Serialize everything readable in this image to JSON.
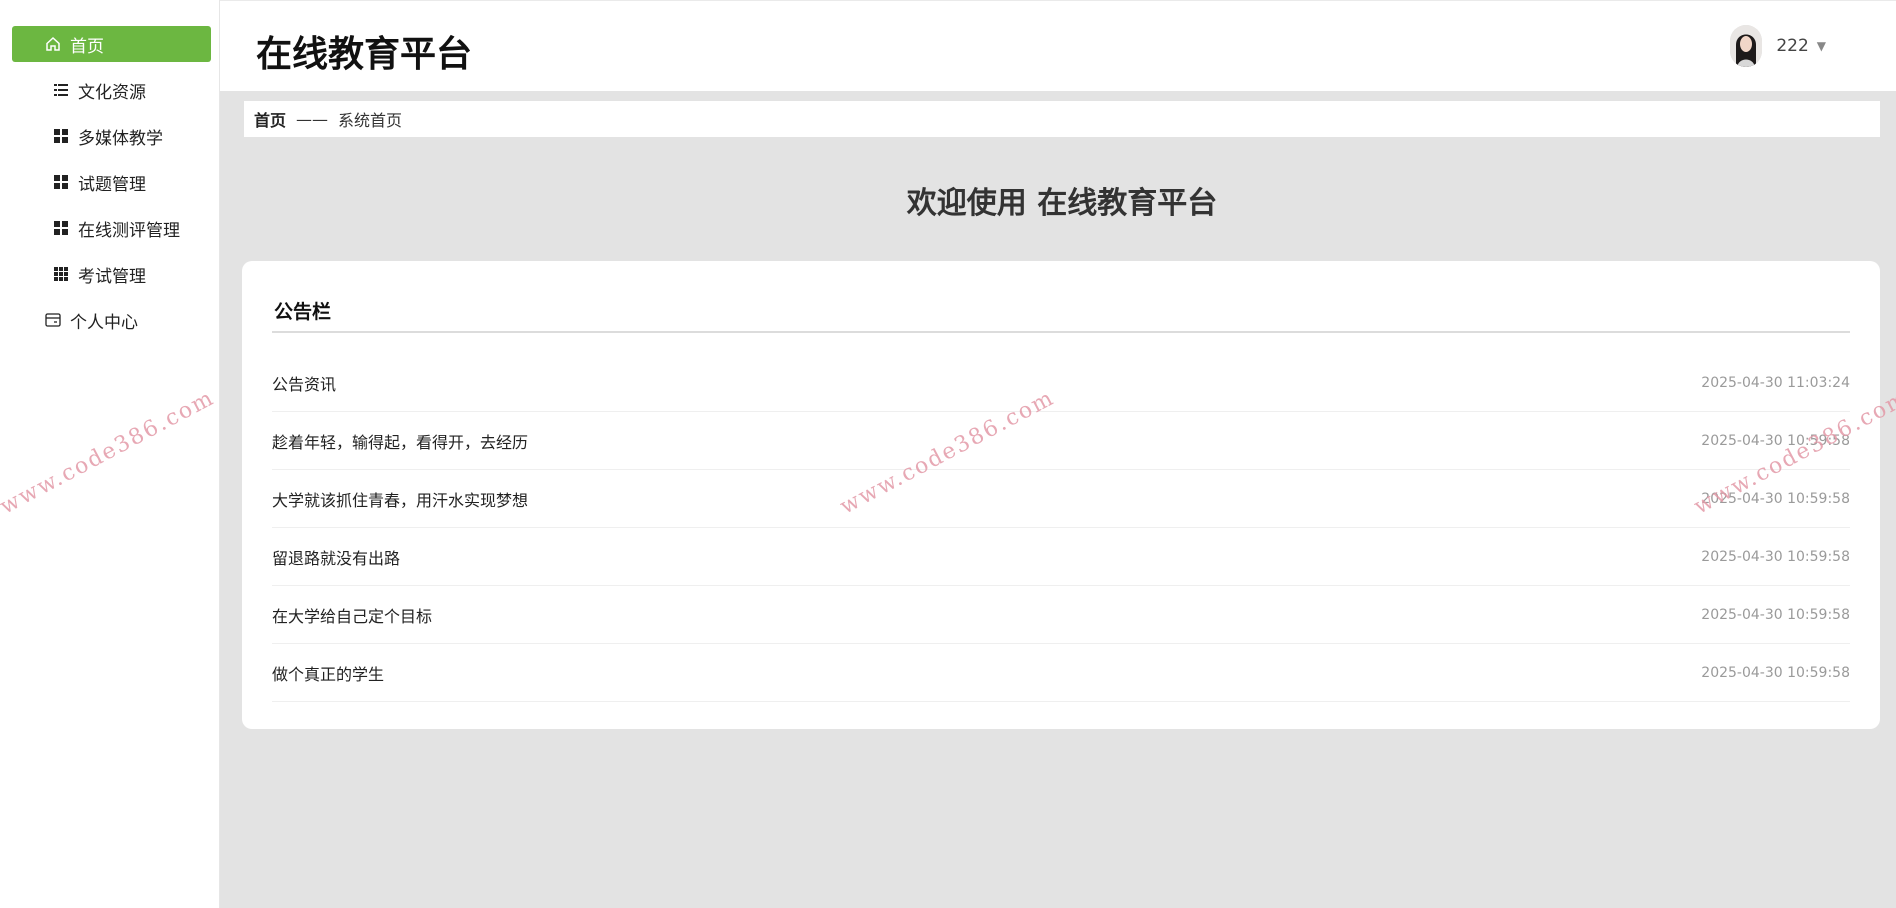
{
  "sidebar": {
    "items": [
      {
        "label": "首页",
        "icon": "home-icon",
        "active": true
      },
      {
        "label": "文化资源",
        "icon": "list-icon"
      },
      {
        "label": "多媒体教学",
        "icon": "grid-icon"
      },
      {
        "label": "试题管理",
        "icon": "grid-icon"
      },
      {
        "label": "在线测评管理",
        "icon": "grid-icon"
      },
      {
        "label": "考试管理",
        "icon": "apps-icon"
      },
      {
        "label": "个人中心",
        "icon": "card-icon"
      }
    ]
  },
  "header": {
    "title": "在线教育平台",
    "username": "222"
  },
  "breadcrumb": {
    "home": "首页",
    "separator": "——",
    "current": "系统首页"
  },
  "welcome": "欢迎使用 在线教育平台",
  "notice": {
    "title": "公告栏",
    "items": [
      {
        "title": "公告资讯",
        "time": "2025-04-30 11:03:24"
      },
      {
        "title": "趁着年轻，输得起，看得开，去经历",
        "time": "2025-04-30 10:59:58"
      },
      {
        "title": "大学就该抓住青春，用汗水实现梦想",
        "time": "2025-04-30 10:59:58"
      },
      {
        "title": "留退路就没有出路",
        "time": "2025-04-30 10:59:58"
      },
      {
        "title": "在大学给自己定个目标",
        "time": "2025-04-30 10:59:58"
      },
      {
        "title": "做个真正的学生",
        "time": "2025-04-30 10:59:58"
      }
    ]
  },
  "watermark": "www.code386.com",
  "colors": {
    "accent": "#6cb741",
    "background": "#e3e3e3",
    "watermark": "#e39aa8"
  }
}
